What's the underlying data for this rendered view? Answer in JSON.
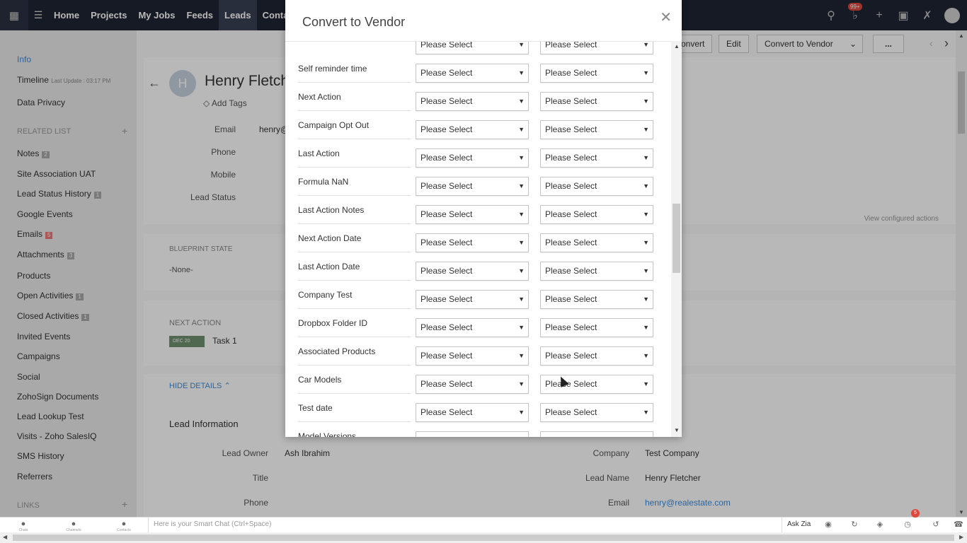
{
  "topbar": {
    "nav": [
      "Home",
      "Projects",
      "My Jobs",
      "Feeds",
      "Leads",
      "Contacts"
    ],
    "notif_badge": "99+"
  },
  "sidebar": {
    "info": "Info",
    "timeline": "Timeline",
    "timeline_meta": "Last Update : 03:17 PM",
    "data_privacy": "Data Privacy",
    "related_head": "RELATED LIST",
    "items": [
      {
        "label": "Notes",
        "count": "2"
      },
      {
        "label": "Site Association UAT",
        "count": ""
      },
      {
        "label": "Lead Status History",
        "count": "1"
      },
      {
        "label": "Google Events",
        "count": ""
      },
      {
        "label": "Emails",
        "count": "5"
      },
      {
        "label": "Attachments",
        "count": "3"
      },
      {
        "label": "Products",
        "count": ""
      },
      {
        "label": "Open Activities",
        "count": "1"
      },
      {
        "label": "Closed Activities",
        "count": "1"
      },
      {
        "label": "Invited Events",
        "count": ""
      },
      {
        "label": "Campaigns",
        "count": ""
      },
      {
        "label": "Social",
        "count": ""
      },
      {
        "label": "ZohoSign Documents",
        "count": ""
      },
      {
        "label": "Lead Lookup Test",
        "count": ""
      },
      {
        "label": "Visits - Zoho SalesIQ",
        "count": ""
      },
      {
        "label": "SMS History",
        "count": ""
      },
      {
        "label": "Referrers",
        "count": ""
      }
    ],
    "links_head": "LINKS"
  },
  "record": {
    "avatar_letter": "H",
    "name": "Henry Fletch",
    "add_tags": "Add Tags",
    "labels": {
      "email": "Email",
      "phone": "Phone",
      "mobile": "Mobile",
      "lead_status": "Lead Status"
    },
    "email_partial": "henry@",
    "blueprint_caption": "BLUEPRINT STATE",
    "blueprint_value": "-None-",
    "next_action_caption": "NEXT ACTION",
    "next_action_date": "DEC 20",
    "next_action_task": "Task 1",
    "hide_details": "HIDE DETAILS",
    "section_title": "Lead Information",
    "view_configured": "View configured actions",
    "toolbar": {
      "convert": "onvert",
      "edit": "Edit",
      "convert_vendor": "Convert to Vendor",
      "more": "..."
    },
    "fields_left": [
      {
        "label": "Lead Owner",
        "value": "Ash Ibrahim"
      },
      {
        "label": "Title",
        "value": ""
      },
      {
        "label": "Phone",
        "value": ""
      }
    ],
    "fields_right": [
      {
        "label": "Company",
        "value": "Test Company"
      },
      {
        "label": "Lead Name",
        "value": "Henry Fletcher"
      },
      {
        "label": "Email",
        "value": "henry@realestate.com"
      }
    ]
  },
  "modal": {
    "title": "Convert to Vendor",
    "select_placeholder": "Please Select",
    "rows": [
      "",
      "Self reminder time",
      "Next Action",
      "Campaign Opt Out",
      "Last Action",
      "Formula NaN",
      "Last Action Notes",
      "Next Action Date",
      "Last Action Date",
      "Company Test",
      "Dropbox Folder ID",
      "Associated Products",
      "Car Models",
      "Test date",
      "Model Versions"
    ]
  },
  "bottombar": {
    "chats": "Chats",
    "channels": "Channels",
    "contacts": "Contacts",
    "smart_chat": "Here is your Smart Chat (Ctrl+Space)",
    "ask_zia": "Ask Zia",
    "alarm_count": "5"
  }
}
